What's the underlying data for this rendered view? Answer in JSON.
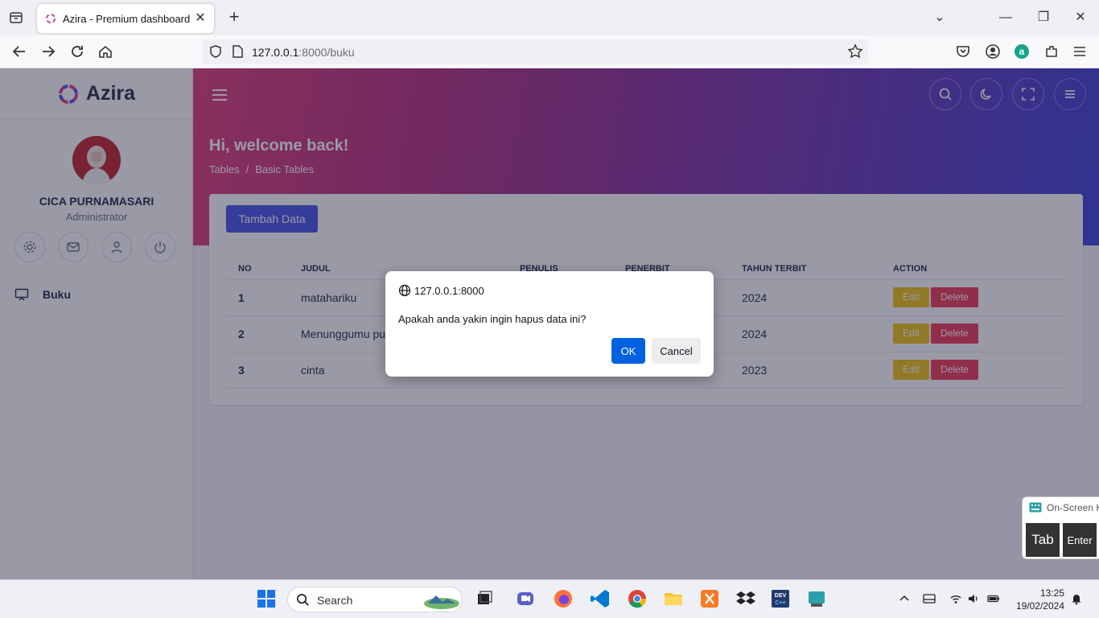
{
  "browser": {
    "tab_title": "Azira - Premium dashboard ui k",
    "url_host": "127.0.0.1",
    "url_rest": ":8000/buku"
  },
  "sidebar": {
    "brand": "Azira",
    "user_name": "CICA PURNAMASARI",
    "user_role": "Administrator",
    "menu": [
      {
        "label": "Buku",
        "icon": "monitor-icon"
      }
    ]
  },
  "header": {
    "welcome": "Hi, welcome back!",
    "breadcrumb": [
      "Tables",
      "Basic Tables"
    ]
  },
  "card": {
    "add_button": "Tambah Data",
    "columns": [
      "NO",
      "JUDUL",
      "PENULIS",
      "PENERBIT",
      "TAHUN TERBIT",
      "ACTION"
    ],
    "rows": [
      {
        "no": "1",
        "judul": "matahariku",
        "penulis": "",
        "penerbit": "",
        "tahun": "2024"
      },
      {
        "no": "2",
        "judul": "Menunggumu pu",
        "penulis": "",
        "penerbit": "",
        "tahun": "2024"
      },
      {
        "no": "3",
        "judul": "cinta",
        "penulis": "",
        "penerbit": "",
        "tahun": "2023"
      }
    ],
    "edit_label": "Edit",
    "delete_label": "Delete"
  },
  "dialog": {
    "origin": "127.0.0.1:8000",
    "message": "Apakah anda yakin ingin hapus data ini?",
    "ok": "OK",
    "cancel": "Cancel"
  },
  "osk": {
    "title": "On-Screen K",
    "tab_key": "Tab",
    "enter_key": "Enter"
  },
  "taskbar": {
    "search_label": "Search",
    "time": "13:25",
    "date": "19/02/2024"
  },
  "colors": {
    "accent": "#4855e8",
    "edit": "#f0c419",
    "delete": "#ef3b5a",
    "dialog_ok": "#0061e0"
  }
}
